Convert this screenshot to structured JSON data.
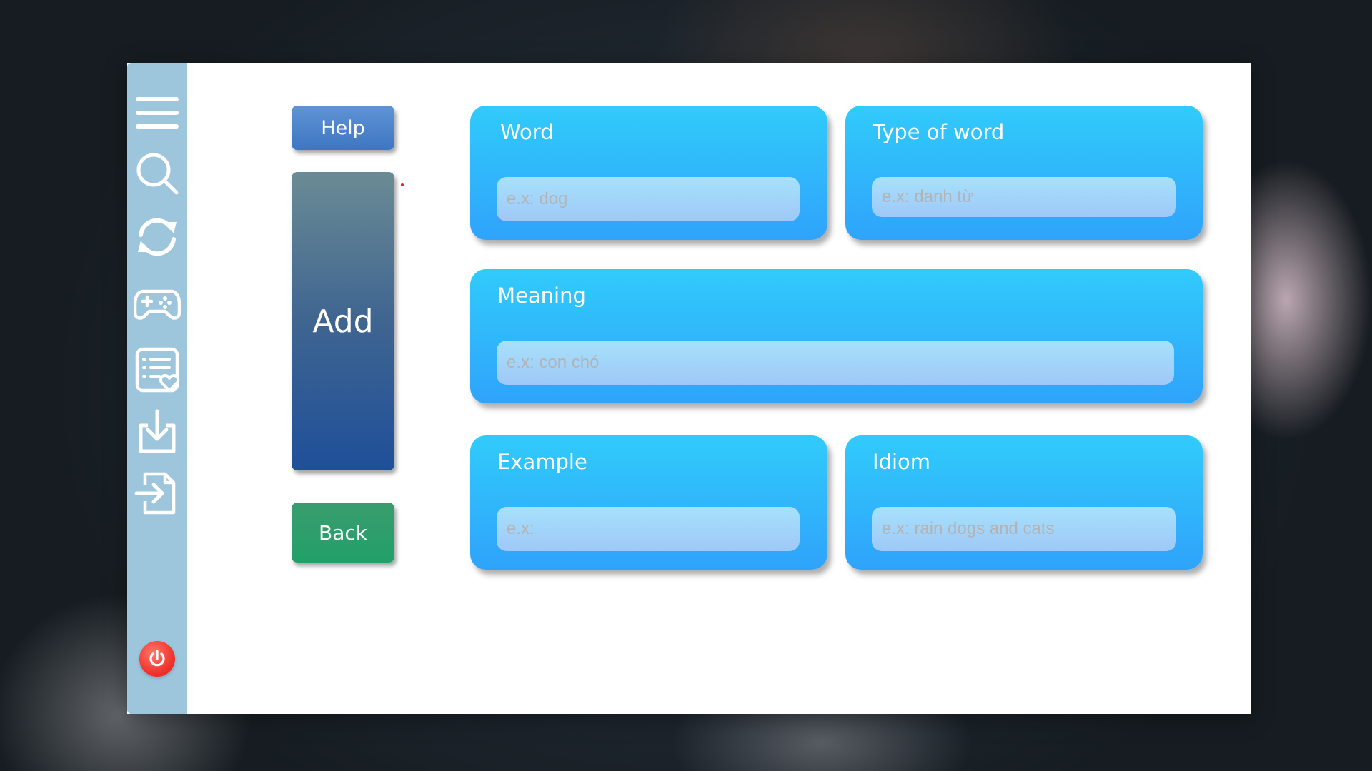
{
  "sidebar": {
    "items": [
      {
        "icon": "menu-icon"
      },
      {
        "icon": "search-icon"
      },
      {
        "icon": "refresh-icon"
      },
      {
        "icon": "gamepad-icon"
      },
      {
        "icon": "favorite-list-icon"
      },
      {
        "icon": "download-icon"
      },
      {
        "icon": "sign-in-icon"
      }
    ],
    "power_icon": "power-icon"
  },
  "actions": {
    "help_label": "Help",
    "add_label": "Add",
    "back_label": "Back"
  },
  "form": {
    "word": {
      "label": "Word",
      "placeholder": "e.x: dog",
      "value": ""
    },
    "type_of_word": {
      "label": "Type of word",
      "placeholder": "e.x: danh từ",
      "value": ""
    },
    "meaning": {
      "label": "Meaning",
      "placeholder": "e.x: con chó",
      "value": ""
    },
    "example": {
      "label": "Example",
      "placeholder": "e.x:",
      "value": ""
    },
    "idiom": {
      "label": "Idiom",
      "placeholder": "e.x: rain dogs and cats",
      "value": ""
    }
  },
  "colors": {
    "sidebar": "#9dc6dd",
    "card_top": "#31cbfb",
    "card_bottom": "#2fa3fb",
    "help_button": "#4a84cb",
    "add_button": "#2f5a92",
    "back_button": "#2a9e6c",
    "power_button": "#f0352e"
  }
}
